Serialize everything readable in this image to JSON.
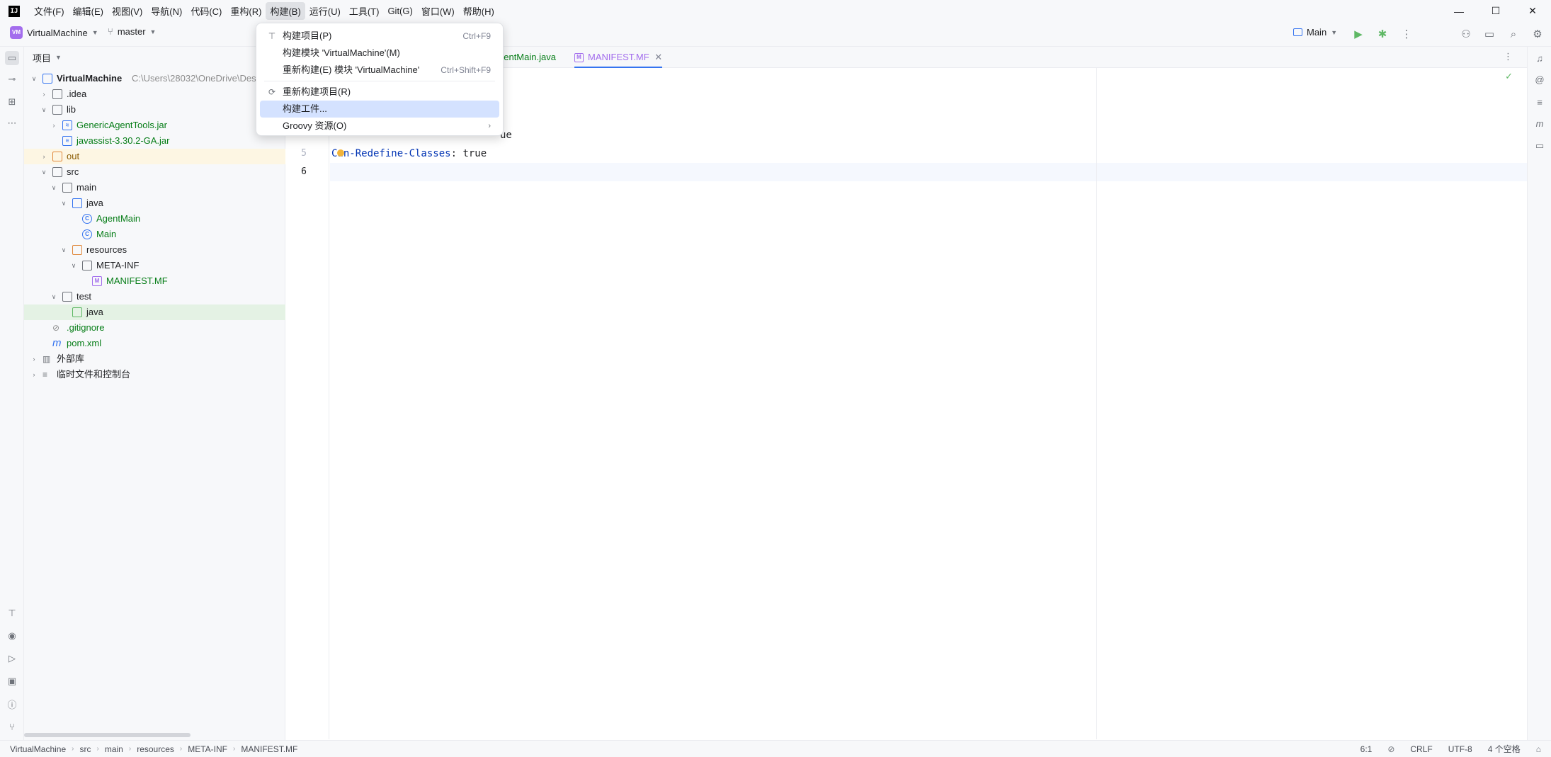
{
  "menubar": {
    "items": [
      "文件(F)",
      "编辑(E)",
      "视图(V)",
      "导航(N)",
      "代码(C)",
      "重构(R)",
      "构建(B)",
      "运行(U)",
      "工具(T)",
      "Git(G)",
      "窗口(W)",
      "帮助(H)"
    ],
    "active_index": 6
  },
  "toolbar": {
    "project_badge": "VM",
    "project_name": "VirtualMachine",
    "branch": "master",
    "run_config": "Main"
  },
  "project_panel": {
    "title": "项目",
    "tree": [
      {
        "label": "VirtualMachine",
        "suffix": "C:\\Users\\28032\\OneDrive\\Des",
        "level": 0,
        "arrow": "down",
        "icon": "module-folder"
      },
      {
        "label": ".idea",
        "level": 1,
        "arrow": "right",
        "icon": "folder"
      },
      {
        "label": "lib",
        "level": 1,
        "arrow": "down",
        "icon": "folder"
      },
      {
        "label": "GenericAgentTools.jar",
        "level": 2,
        "arrow": "right",
        "icon": "jar"
      },
      {
        "label": "javassist-3.30.2-GA.jar",
        "level": 2,
        "arrow": "none",
        "icon": "jar"
      },
      {
        "label": "out",
        "level": 1,
        "arrow": "right",
        "icon": "folder-orange"
      },
      {
        "label": "src",
        "level": 1,
        "arrow": "down",
        "icon": "folder"
      },
      {
        "label": "main",
        "level": 2,
        "arrow": "down",
        "icon": "folder"
      },
      {
        "label": "java",
        "level": 3,
        "arrow": "down",
        "icon": "folder-blue"
      },
      {
        "label": "AgentMain",
        "level": 4,
        "arrow": "none",
        "icon": "class"
      },
      {
        "label": "Main",
        "level": 4,
        "arrow": "none",
        "icon": "class"
      },
      {
        "label": "resources",
        "level": 3,
        "arrow": "down",
        "icon": "folder-resources"
      },
      {
        "label": "META-INF",
        "level": 4,
        "arrow": "down",
        "icon": "folder"
      },
      {
        "label": "MANIFEST.MF",
        "level": 5,
        "arrow": "none",
        "icon": "manifest"
      },
      {
        "label": "test",
        "level": 2,
        "arrow": "down",
        "icon": "folder"
      },
      {
        "label": "java",
        "level": 3,
        "arrow": "none",
        "icon": "folder-green"
      },
      {
        "label": ".gitignore",
        "level": 1,
        "arrow": "none",
        "icon": "ignore"
      },
      {
        "label": "pom.xml",
        "level": 1,
        "arrow": "none",
        "icon": "maven"
      },
      {
        "label": "外部库",
        "level": 0,
        "arrow": "right",
        "icon": "library"
      },
      {
        "label": "临时文件和控制台",
        "level": 0,
        "arrow": "right",
        "icon": "scratch"
      }
    ]
  },
  "editor": {
    "tabs": [
      {
        "label": "AgentMain.java",
        "visible_label": "gentMain.java",
        "active": false
      },
      {
        "label": "MANIFEST.MF",
        "active": true
      }
    ],
    "lines": [
      {
        "no": "5",
        "key": "Can-Redefine-Classes",
        "value": " true"
      },
      {
        "no": "6",
        "key": "",
        "value": ""
      }
    ],
    "partial_line_text": "ue"
  },
  "build_menu": {
    "items": [
      {
        "label": "构建项目(P)",
        "shortcut": "Ctrl+F9",
        "icon": "hammer"
      },
      {
        "label": "构建模块 'VirtualMachine'(M)",
        "shortcut": "",
        "icon": ""
      },
      {
        "label": "重新构建(E) 模块 'VirtualMachine'",
        "shortcut": "Ctrl+Shift+F9",
        "icon": ""
      },
      {
        "label": "重新构建项目(R)",
        "shortcut": "",
        "icon": "rebuild",
        "separator_before": true
      },
      {
        "label": "构建工件...",
        "shortcut": "",
        "icon": "",
        "selected": true
      },
      {
        "label": "Groovy 资源(O)",
        "shortcut": "",
        "icon": "",
        "submenu": true
      }
    ]
  },
  "statusbar": {
    "breadcrumb": [
      "VirtualMachine",
      "src",
      "main",
      "resources",
      "META-INF",
      "MANIFEST.MF"
    ],
    "position": "6:1",
    "line_ending": "CRLF",
    "encoding": "UTF-8",
    "indent": "4 个空格"
  },
  "colors": {
    "accent": "#3574f0",
    "green_text": "#067d17",
    "keyword": "#0033b3",
    "manifest_purple": "#a36ded"
  }
}
